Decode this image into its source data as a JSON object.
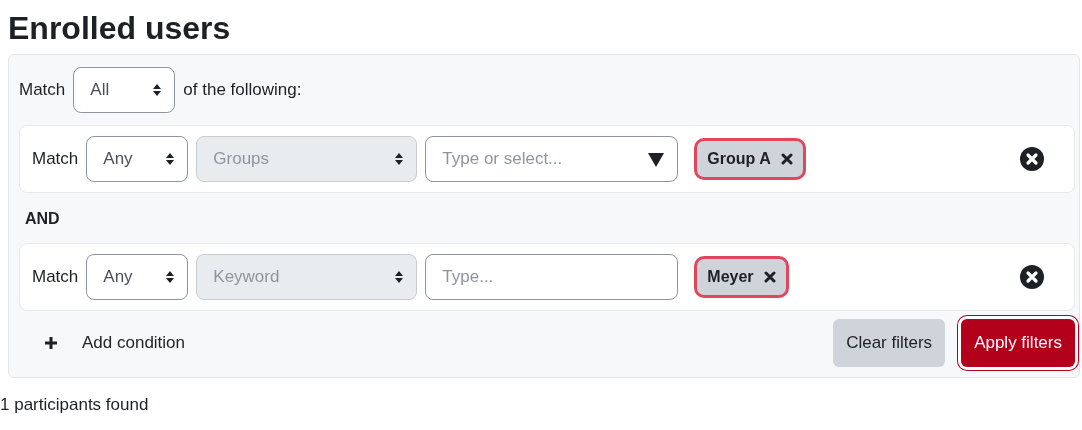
{
  "page_title": "Enrolled users",
  "filter": {
    "match_label": "Match",
    "match_value": "All",
    "match_suffix": "of the following:",
    "conditions": [
      {
        "kind": "autocomplete",
        "match_label": "Match",
        "match_value": "Any",
        "type_value": "Groups",
        "placeholder": "Type or select...",
        "tags": [
          "Group A"
        ]
      },
      {
        "kind": "text",
        "joiner": "AND",
        "match_label": "Match",
        "match_value": "Any",
        "type_value": "Keyword",
        "placeholder": "Type...",
        "tags": [
          "Meyer"
        ]
      }
    ],
    "add_label": "Add condition",
    "buttons": [
      {
        "kind": "secondary",
        "label": "Clear filters"
      },
      {
        "kind": "primary",
        "label": "Apply filters"
      }
    ]
  },
  "result": "1 participants found"
}
